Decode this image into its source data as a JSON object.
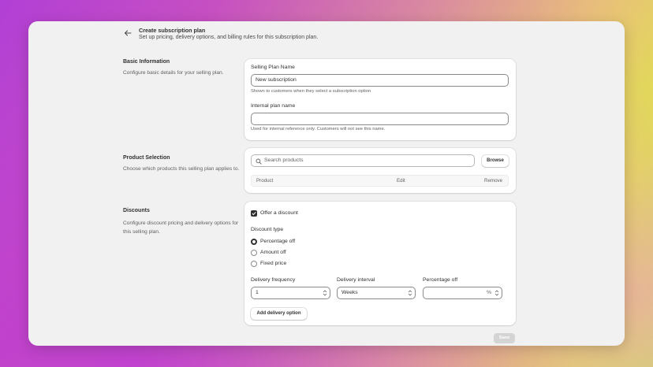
{
  "header": {
    "title": "Create subscription plan",
    "subtitle": "Set up pricing, delivery options, and billing rules for this subscription plan."
  },
  "basic_info": {
    "label": "Basic Information",
    "description": "Configure basic details for your selling plan.",
    "plan_name_label": "Selling Plan Name",
    "plan_name_value": "New subscription",
    "plan_name_help": "Shown to customers when they select a subscription option",
    "internal_name_label": "Internal plan name",
    "internal_name_value": "",
    "internal_name_help": "Used for internal reference only. Customers will not see this name."
  },
  "product_selection": {
    "label": "Product Selection",
    "description": "Choose which products this selling plan applies to.",
    "search_placeholder": "Search products",
    "browse_label": "Browse",
    "columns": [
      "Product",
      "Edit",
      "Remove"
    ]
  },
  "discounts": {
    "label": "Discounts",
    "description": "Configure discount pricing and delivery options for this selling plan.",
    "offer_discount_label": "Offer a discount",
    "offer_discount_checked": true,
    "discount_type_label": "Discount type",
    "discount_types": [
      {
        "label": "Percentage off",
        "selected": true
      },
      {
        "label": "Amount off",
        "selected": false
      },
      {
        "label": "Fixed price",
        "selected": false
      }
    ],
    "delivery_frequency_label": "Delivery frequency",
    "delivery_frequency_value": "1",
    "delivery_interval_label": "Delivery interval",
    "delivery_interval_value": "Weeks",
    "percentage_off_label": "Percentage off",
    "percentage_off_value": "",
    "percentage_suffix": "%",
    "add_delivery_label": "Add delivery option"
  },
  "footer": {
    "save_label": "Save"
  },
  "colors": {
    "text_primary": "#303030",
    "text_secondary": "#616161",
    "card_bg": "#ffffff",
    "page_bg": "#f1f1f1",
    "save_disabled": "#d4d4d4"
  }
}
